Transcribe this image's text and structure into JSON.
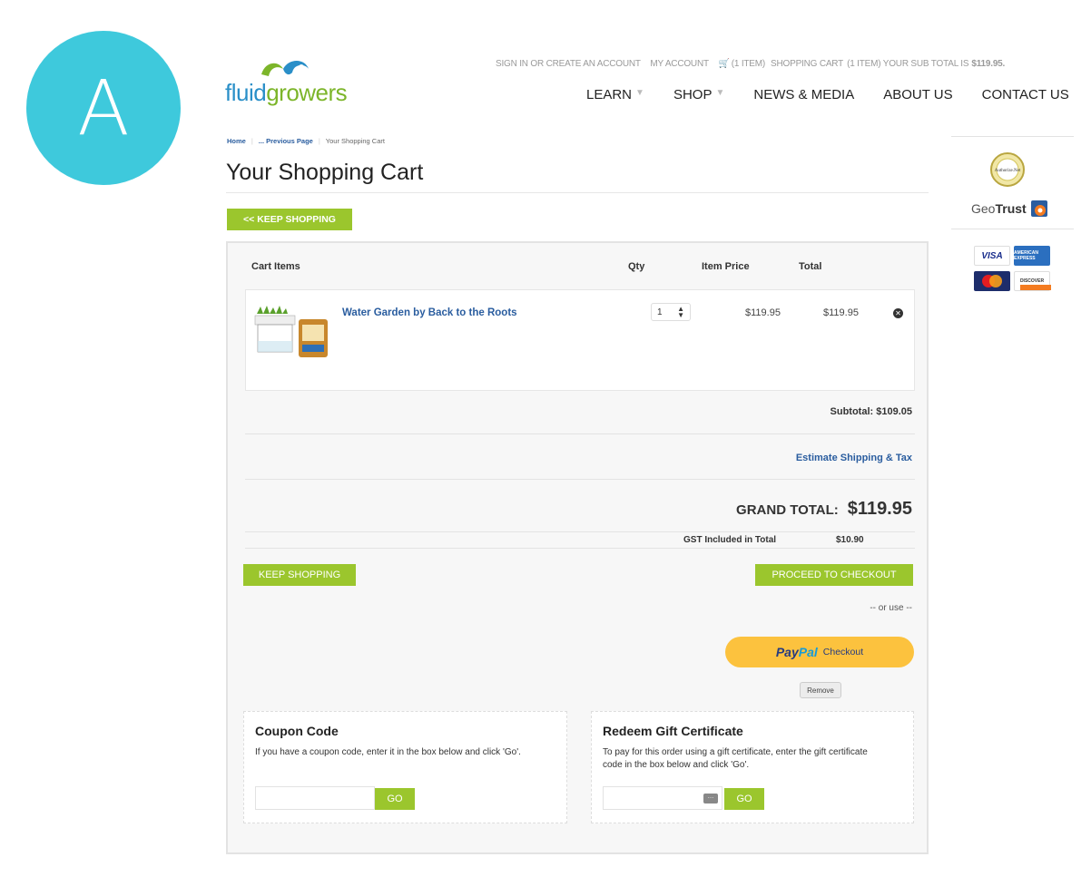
{
  "overlay_badge": "A",
  "brand": {
    "part1": "fluid",
    "part2": "growers"
  },
  "utility_links": {
    "signin": "SIGN IN OR CREATE AN ACCOUNT",
    "my_account": "MY ACCOUNT",
    "cart_count": "(1 ITEM)",
    "shopping_cart": "SHOPPING CART",
    "subtotal_text": "(1 ITEM) YOUR SUB TOTAL IS",
    "subtotal_amount": "$119.95."
  },
  "nav": [
    {
      "label": "LEARN",
      "has_caret": true
    },
    {
      "label": "SHOP",
      "has_caret": true
    },
    {
      "label": "NEWS & MEDIA",
      "has_caret": false
    },
    {
      "label": "ABOUT US",
      "has_caret": false
    },
    {
      "label": "CONTACT US",
      "has_caret": false
    }
  ],
  "breadcrumb": {
    "home": "Home",
    "previous": "... Previous Page",
    "current": "Your Shopping Cart"
  },
  "page_title": "Your Shopping Cart",
  "keep_shopping_top": "<< KEEP SHOPPING",
  "sidebar": {
    "authorize_net": "Authorize.Net",
    "geotrust_a": "Geo",
    "geotrust_b": "Trust",
    "cards": [
      "VISA",
      "AMERICAN EXPRESS",
      "MasterCard",
      "DISCOVER"
    ]
  },
  "cart": {
    "headers": {
      "items": "Cart Items",
      "qty": "Qty",
      "item_price": "Item Price",
      "total": "Total"
    },
    "items": [
      {
        "name": "Water Garden by Back to the Roots",
        "qty": "1",
        "price": "$119.95",
        "total": "$119.95"
      }
    ],
    "subtotal": "Subtotal: $109.05",
    "estimate_link": "Estimate Shipping & Tax",
    "grand_label": "GRAND TOTAL:",
    "grand_value": "$119.95",
    "gst_label": "GST Included in Total",
    "gst_value": "$10.90",
    "keep_shopping": "KEEP SHOPPING",
    "checkout": "PROCEED TO CHECKOUT",
    "or_use": "-- or use --",
    "paypal_a": "Pay",
    "paypal_b": "Pal",
    "paypal_checkout": "Checkout",
    "remove": "Remove"
  },
  "coupon": {
    "title": "Coupon Code",
    "desc": "If you have a coupon code, enter it in the box below and click 'Go'.",
    "go": "GO"
  },
  "gift": {
    "title": "Redeem Gift Certificate",
    "desc": "To pay for this order using a gift certificate, enter the gift certificate code in the box below and click 'Go'.",
    "go": "GO"
  },
  "colors": {
    "accent_green": "#9bc62d",
    "link_blue": "#2a5d9f",
    "badge_teal": "#3ec9dc",
    "paypal_yellow": "#fcc23e"
  }
}
